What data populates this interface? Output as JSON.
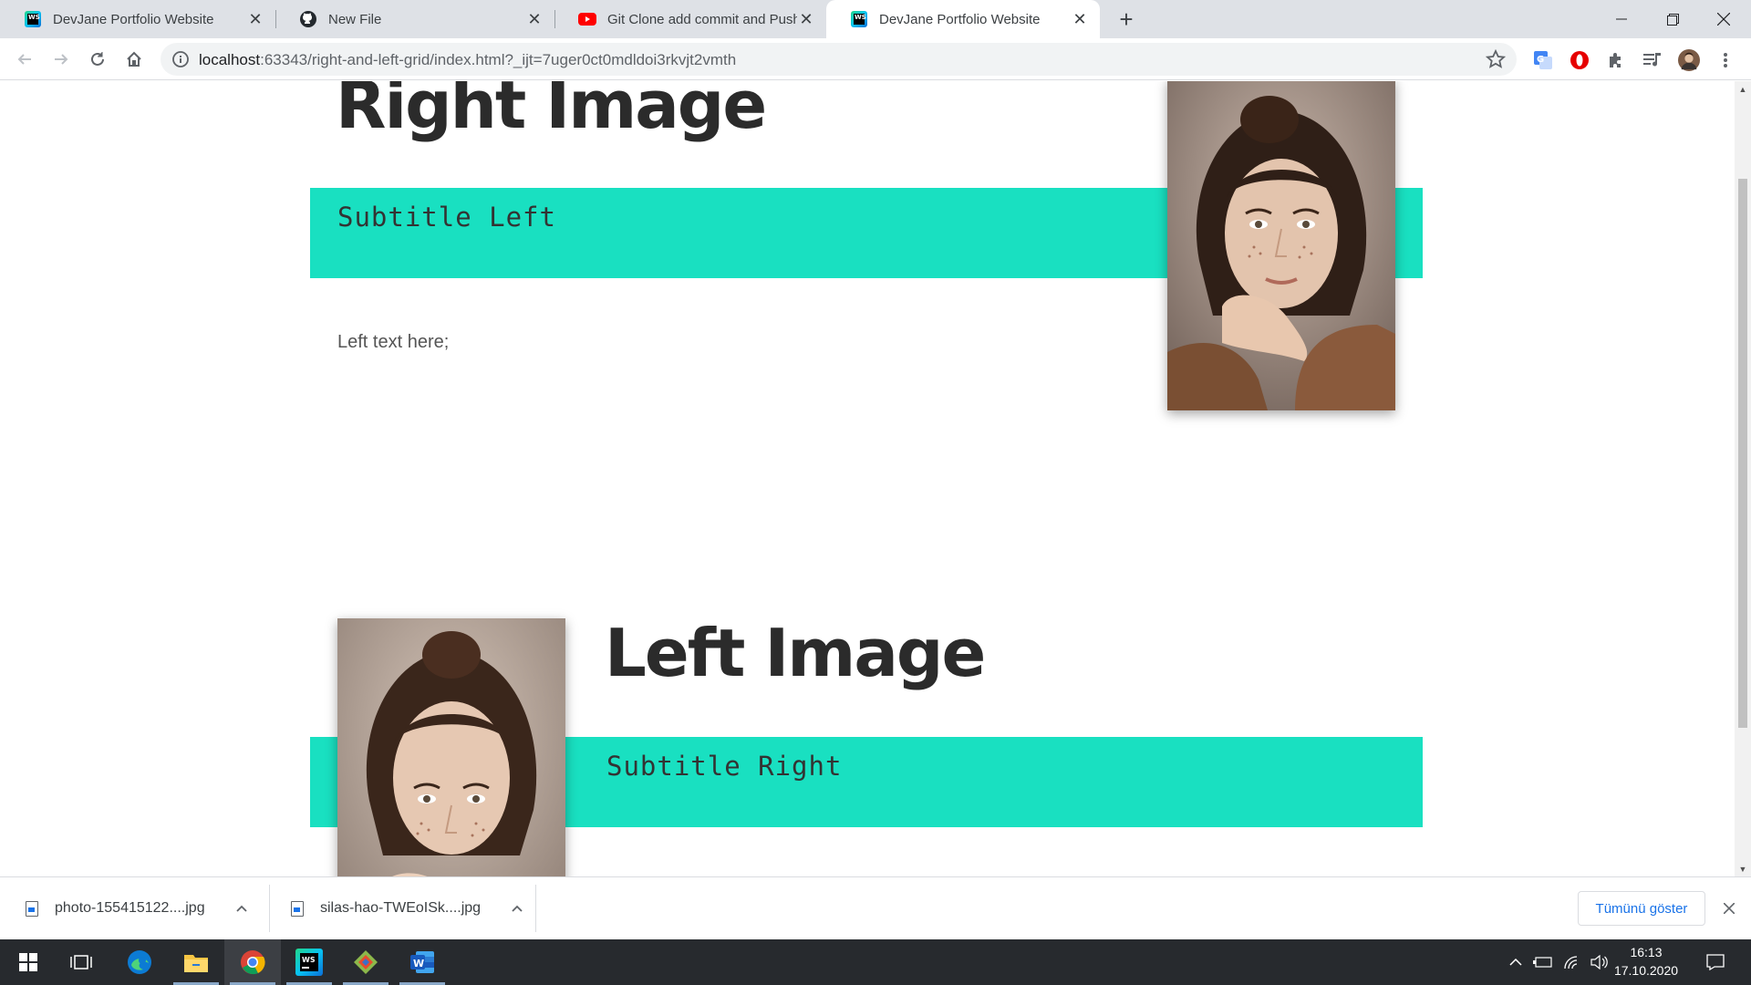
{
  "browser": {
    "tabs": [
      {
        "title": "DevJane Portfolio Website",
        "icon": "webstorm-icon",
        "active": false
      },
      {
        "title": "New File",
        "icon": "github-icon",
        "active": false
      },
      {
        "title": "Git Clone add commit and Push t",
        "icon": "youtube-icon",
        "active": false
      },
      {
        "title": "DevJane Portfolio Website",
        "icon": "webstorm-icon",
        "active": true
      }
    ],
    "url_host": "localhost",
    "url_rest": ":63343/right-and-left-grid/index.html?_ijt=7uger0ct0mdldoi3rkvjt2vmth"
  },
  "page": {
    "section1": {
      "title": "Right Image",
      "subtitle": "Subtitle Left",
      "text": "Left text here;"
    },
    "section2": {
      "title": "Left Image",
      "subtitle": "Subtitle Right"
    },
    "accent_color": "#19e0c1"
  },
  "downloads": {
    "items": [
      {
        "name": "photo-155415122....jpg"
      },
      {
        "name": "silas-hao-TWEoISk....jpg"
      }
    ],
    "show_all": "Tümünü göster"
  },
  "taskbar": {
    "time": "16:13",
    "date": "17.10.2020"
  }
}
